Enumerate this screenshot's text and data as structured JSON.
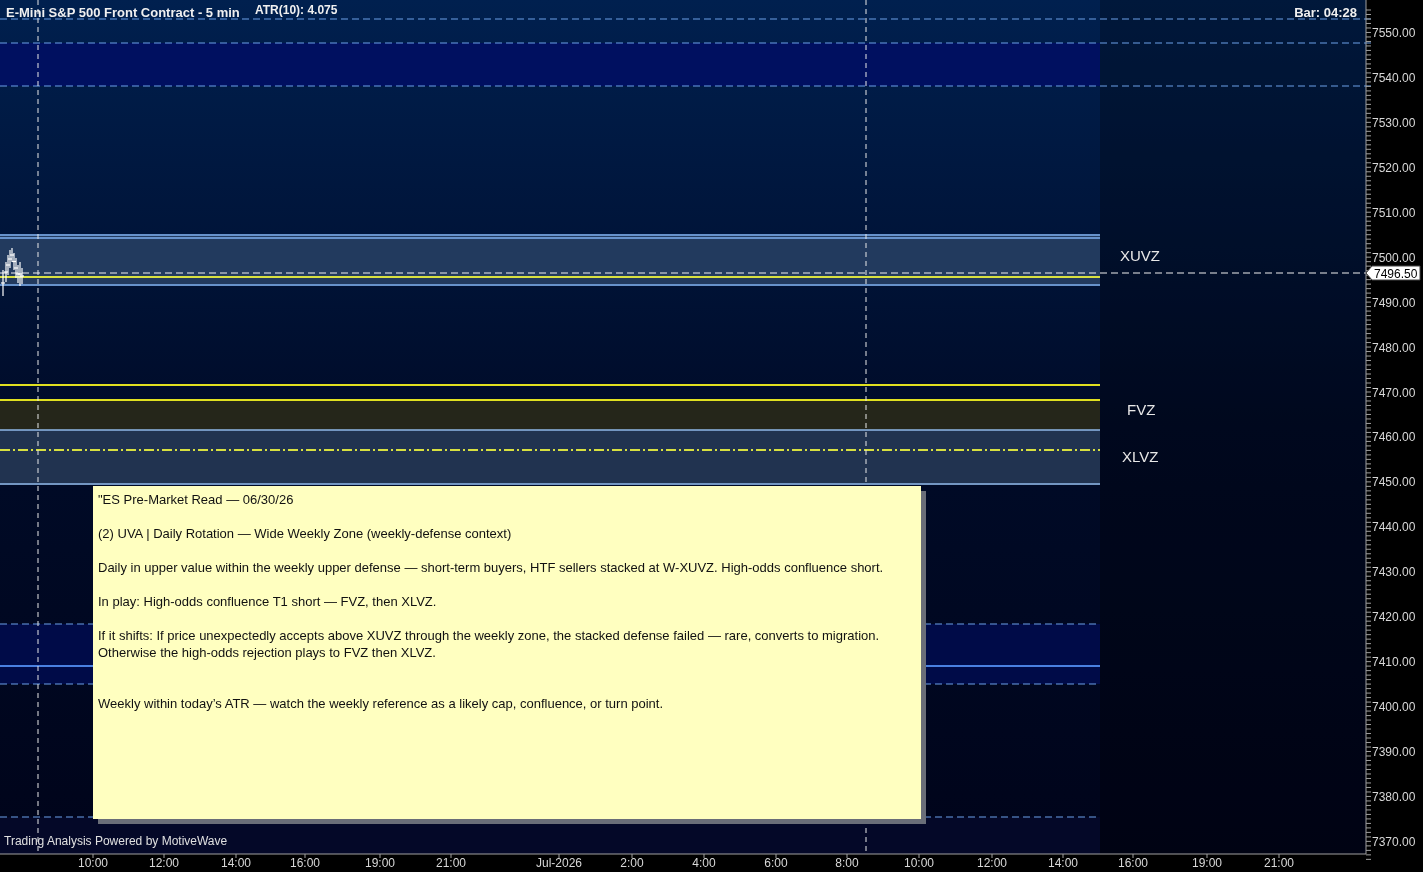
{
  "chart": {
    "title": "E-Mini S&P 500 Front Contract - 5 min",
    "indicator": "ATR(10): 4.075",
    "bar_timer": "Bar: 04:28",
    "zone_labels": [
      "XUVZ",
      "FVZ",
      "XLVZ"
    ],
    "price_axis": [
      "7550.00",
      "7540.00",
      "7530.00",
      "7520.00",
      "7510.00",
      "7500.00",
      "7490.00",
      "7480.00",
      "7470.00",
      "7460.00",
      "7450.00",
      "7440.00",
      "7430.00",
      "7420.00",
      "7410.00",
      "7400.00",
      "7390.00",
      "7380.00",
      "7370.00"
    ],
    "current_price": "7496.50",
    "time_axis": [
      "10:00",
      "12:00",
      "14:00",
      "16:00",
      "19:00",
      "21:00",
      "Jul-2026",
      "2:00",
      "4:00",
      "6:00",
      "8:00",
      "10:00",
      "12:00",
      "14:00",
      "16:00",
      "19:00",
      "21:00"
    ]
  },
  "note": {
    "paragraphs": [
      "\"ES Pre-Market Read — 06/30/26",
      "(2) UVA | Daily Rotation — Wide Weekly Zone (weekly-defense context)",
      "Daily in upper value within the weekly upper defense — short-term buyers, HTF sellers stacked at W-XUVZ. High-odds confluence short.",
      "In play: High-odds confluence T1 short — FVZ, then XLVZ.",
      "If it shifts: If price unexpectedly accepts above XUVZ through the weekly zone, the stacked defense failed — rare, converts to migration. Otherwise the high-odds rejection plays to FVZ then XLVZ.",
      "Weekly within today’s ATR — watch the weekly reference as a likely cap, confluence, or turn point."
    ]
  },
  "footer": "Trading Analysis Powered by MotiveWave"
}
